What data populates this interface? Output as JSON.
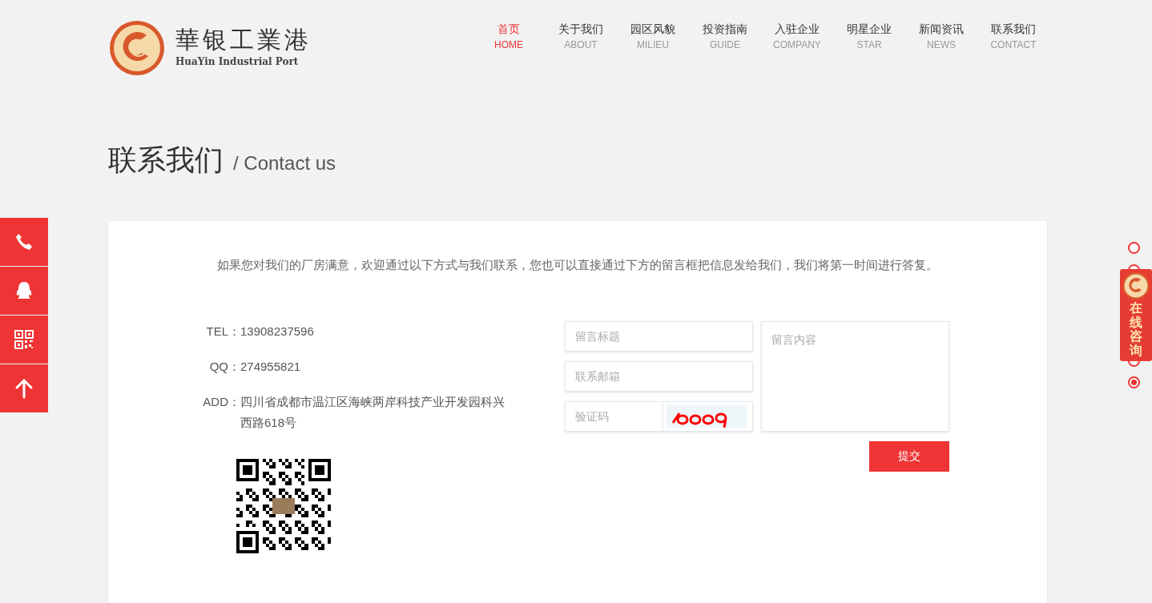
{
  "logo": {
    "title": "華银工業港",
    "subtitle": "HuaYin Industrial Port"
  },
  "nav": [
    {
      "label": "首页",
      "sub": "HOME",
      "selected": true
    },
    {
      "label": "关于我们",
      "sub": "ABOUT",
      "selected": false
    },
    {
      "label": "园区风貌",
      "sub": "MILIEU",
      "selected": false
    },
    {
      "label": "投资指南",
      "sub": "GUIDE",
      "selected": false
    },
    {
      "label": "入驻企业",
      "sub": "COMPANY",
      "selected": false
    },
    {
      "label": "明星企业",
      "sub": "STAR",
      "selected": false
    },
    {
      "label": "新闻资讯",
      "sub": "NEWS",
      "selected": false
    },
    {
      "label": "联系我们",
      "sub": "CONTACT",
      "selected": false
    }
  ],
  "page_title": {
    "main": "联系我们",
    "sub": "/ Contact us"
  },
  "intro": "如果您对我们的厂房满意，欢迎通过以下方式与我们联系，您也可以直接通过下方的留言框把信息发给我们，我们将第一时间进行答复。",
  "contacts": [
    {
      "label": "TEL：",
      "value": "13908237596"
    },
    {
      "label": "QQ：",
      "value": "274955821"
    },
    {
      "label": "ADD：",
      "value": "四川省成都市温江区海峡两岸科技产业开发园科兴西路618号"
    }
  ],
  "form": {
    "title_placeholder": "留言标题",
    "email_placeholder": "联系邮箱",
    "captcha_placeholder": "验证码",
    "content_placeholder": "留言内容",
    "submit": "提交"
  },
  "side_buttons": [
    {
      "kind": "phone"
    },
    {
      "kind": "qq"
    },
    {
      "kind": "qr"
    },
    {
      "kind": "top"
    }
  ],
  "consult": {
    "label": "在线咨询"
  },
  "page_dots": [
    {
      "selected": false
    },
    {
      "selected": false
    },
    {
      "selected": false
    },
    {
      "selected": true
    }
  ]
}
